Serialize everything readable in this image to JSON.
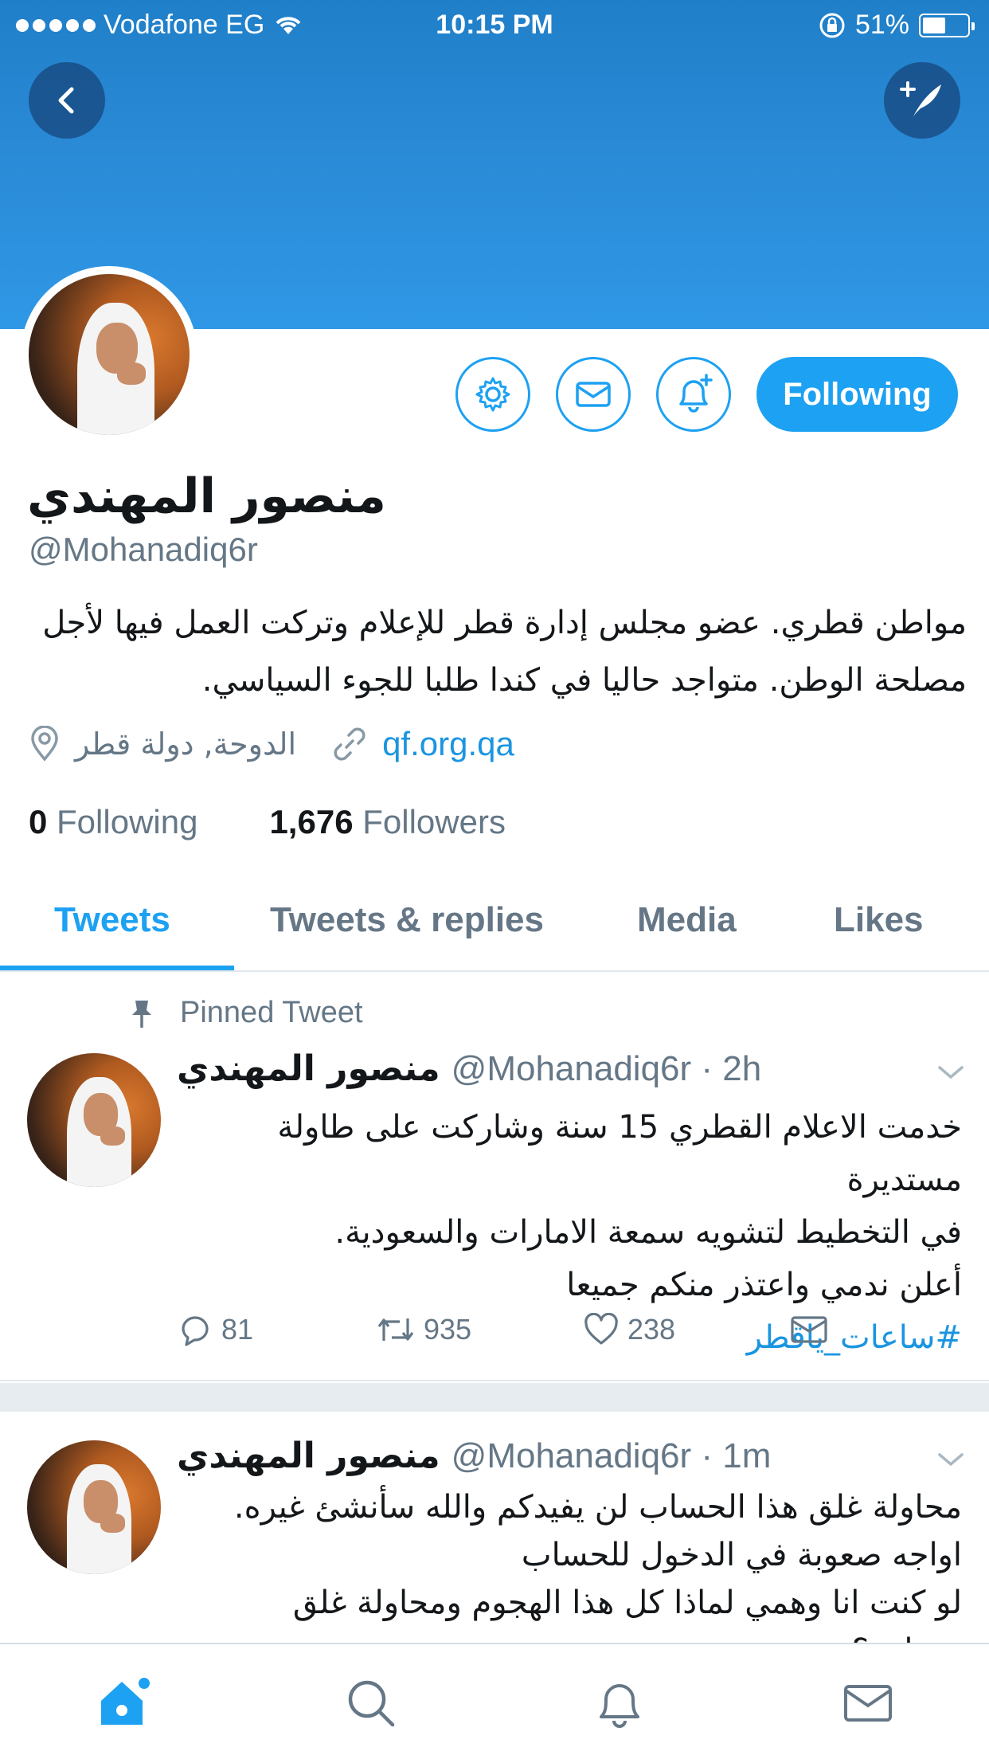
{
  "status_bar": {
    "carrier": "Vodafone EG",
    "time": "10:15 PM",
    "battery": "51%",
    "battery_level": 0.51,
    "icons": [
      "signal-dots-icon",
      "wifi-icon",
      "orientation-lock-icon",
      "battery-icon"
    ]
  },
  "header": {
    "back_icon": "chevron-left-icon",
    "compose_icon": "compose-tweet-icon"
  },
  "profile": {
    "name": "منصور المهندي",
    "handle": "@Mohanadiq6r",
    "bio_line1": "مواطن قطري. عضو مجلس إدارة قطر للإعلام وتركت العمل فيها لأجل",
    "bio_line2": "مصلحة الوطن. متواجد حاليا في كندا طلبا للجوء السياسي.",
    "location": "الدوحة, دولة قطر",
    "website": "qf.org.qa",
    "following_count": "0",
    "following_label": "Following",
    "followers_count": "1,676",
    "followers_label": "Followers",
    "follow_button": "Following",
    "action_icons": [
      "gear-icon",
      "envelope-icon",
      "bell-add-icon"
    ]
  },
  "tabs": {
    "tweets": "Tweets",
    "replies": "Tweets & replies",
    "media": "Media",
    "likes": "Likes",
    "active": "Tweets"
  },
  "tweets": [
    {
      "pinned_label": "Pinned Tweet",
      "name": "منصور المهندي",
      "handle": "@Mohanadiq6r",
      "time": "· 2h",
      "lines": [
        "خدمت الاعلام القطري 15 سنة وشاركت على طاولة مستديرة",
        "في التخطيط لتشويه سمعة الامارات والسعودية.",
        "أعلن ندمي واعتذر منكم جميعا"
      ],
      "hashtag": "#ساعات_ياقطر",
      "replies": "81",
      "retweets": "935",
      "likes": "238"
    },
    {
      "name": "منصور المهندي",
      "handle": "@Mohanadiq6r",
      "time": "· 1m",
      "lines": [
        "محاولة غلق هذا الحساب لن يفيدكم والله سأنشئ غيره.",
        "اواجه صعوبة في الدخول للحساب",
        "لو كنت انا وهمي لماذا كل هذا الهجوم ومحاولة غلق حسابي؟"
      ]
    }
  ],
  "bottom_bar": {
    "items": [
      "home-icon",
      "search-icon",
      "notifications-icon",
      "messages-icon"
    ],
    "active": "home-icon"
  },
  "colors": {
    "accent": "#1da1f2",
    "banner": "#2a8ad6",
    "muted_text": "#657786",
    "link": "#1b95e0"
  }
}
